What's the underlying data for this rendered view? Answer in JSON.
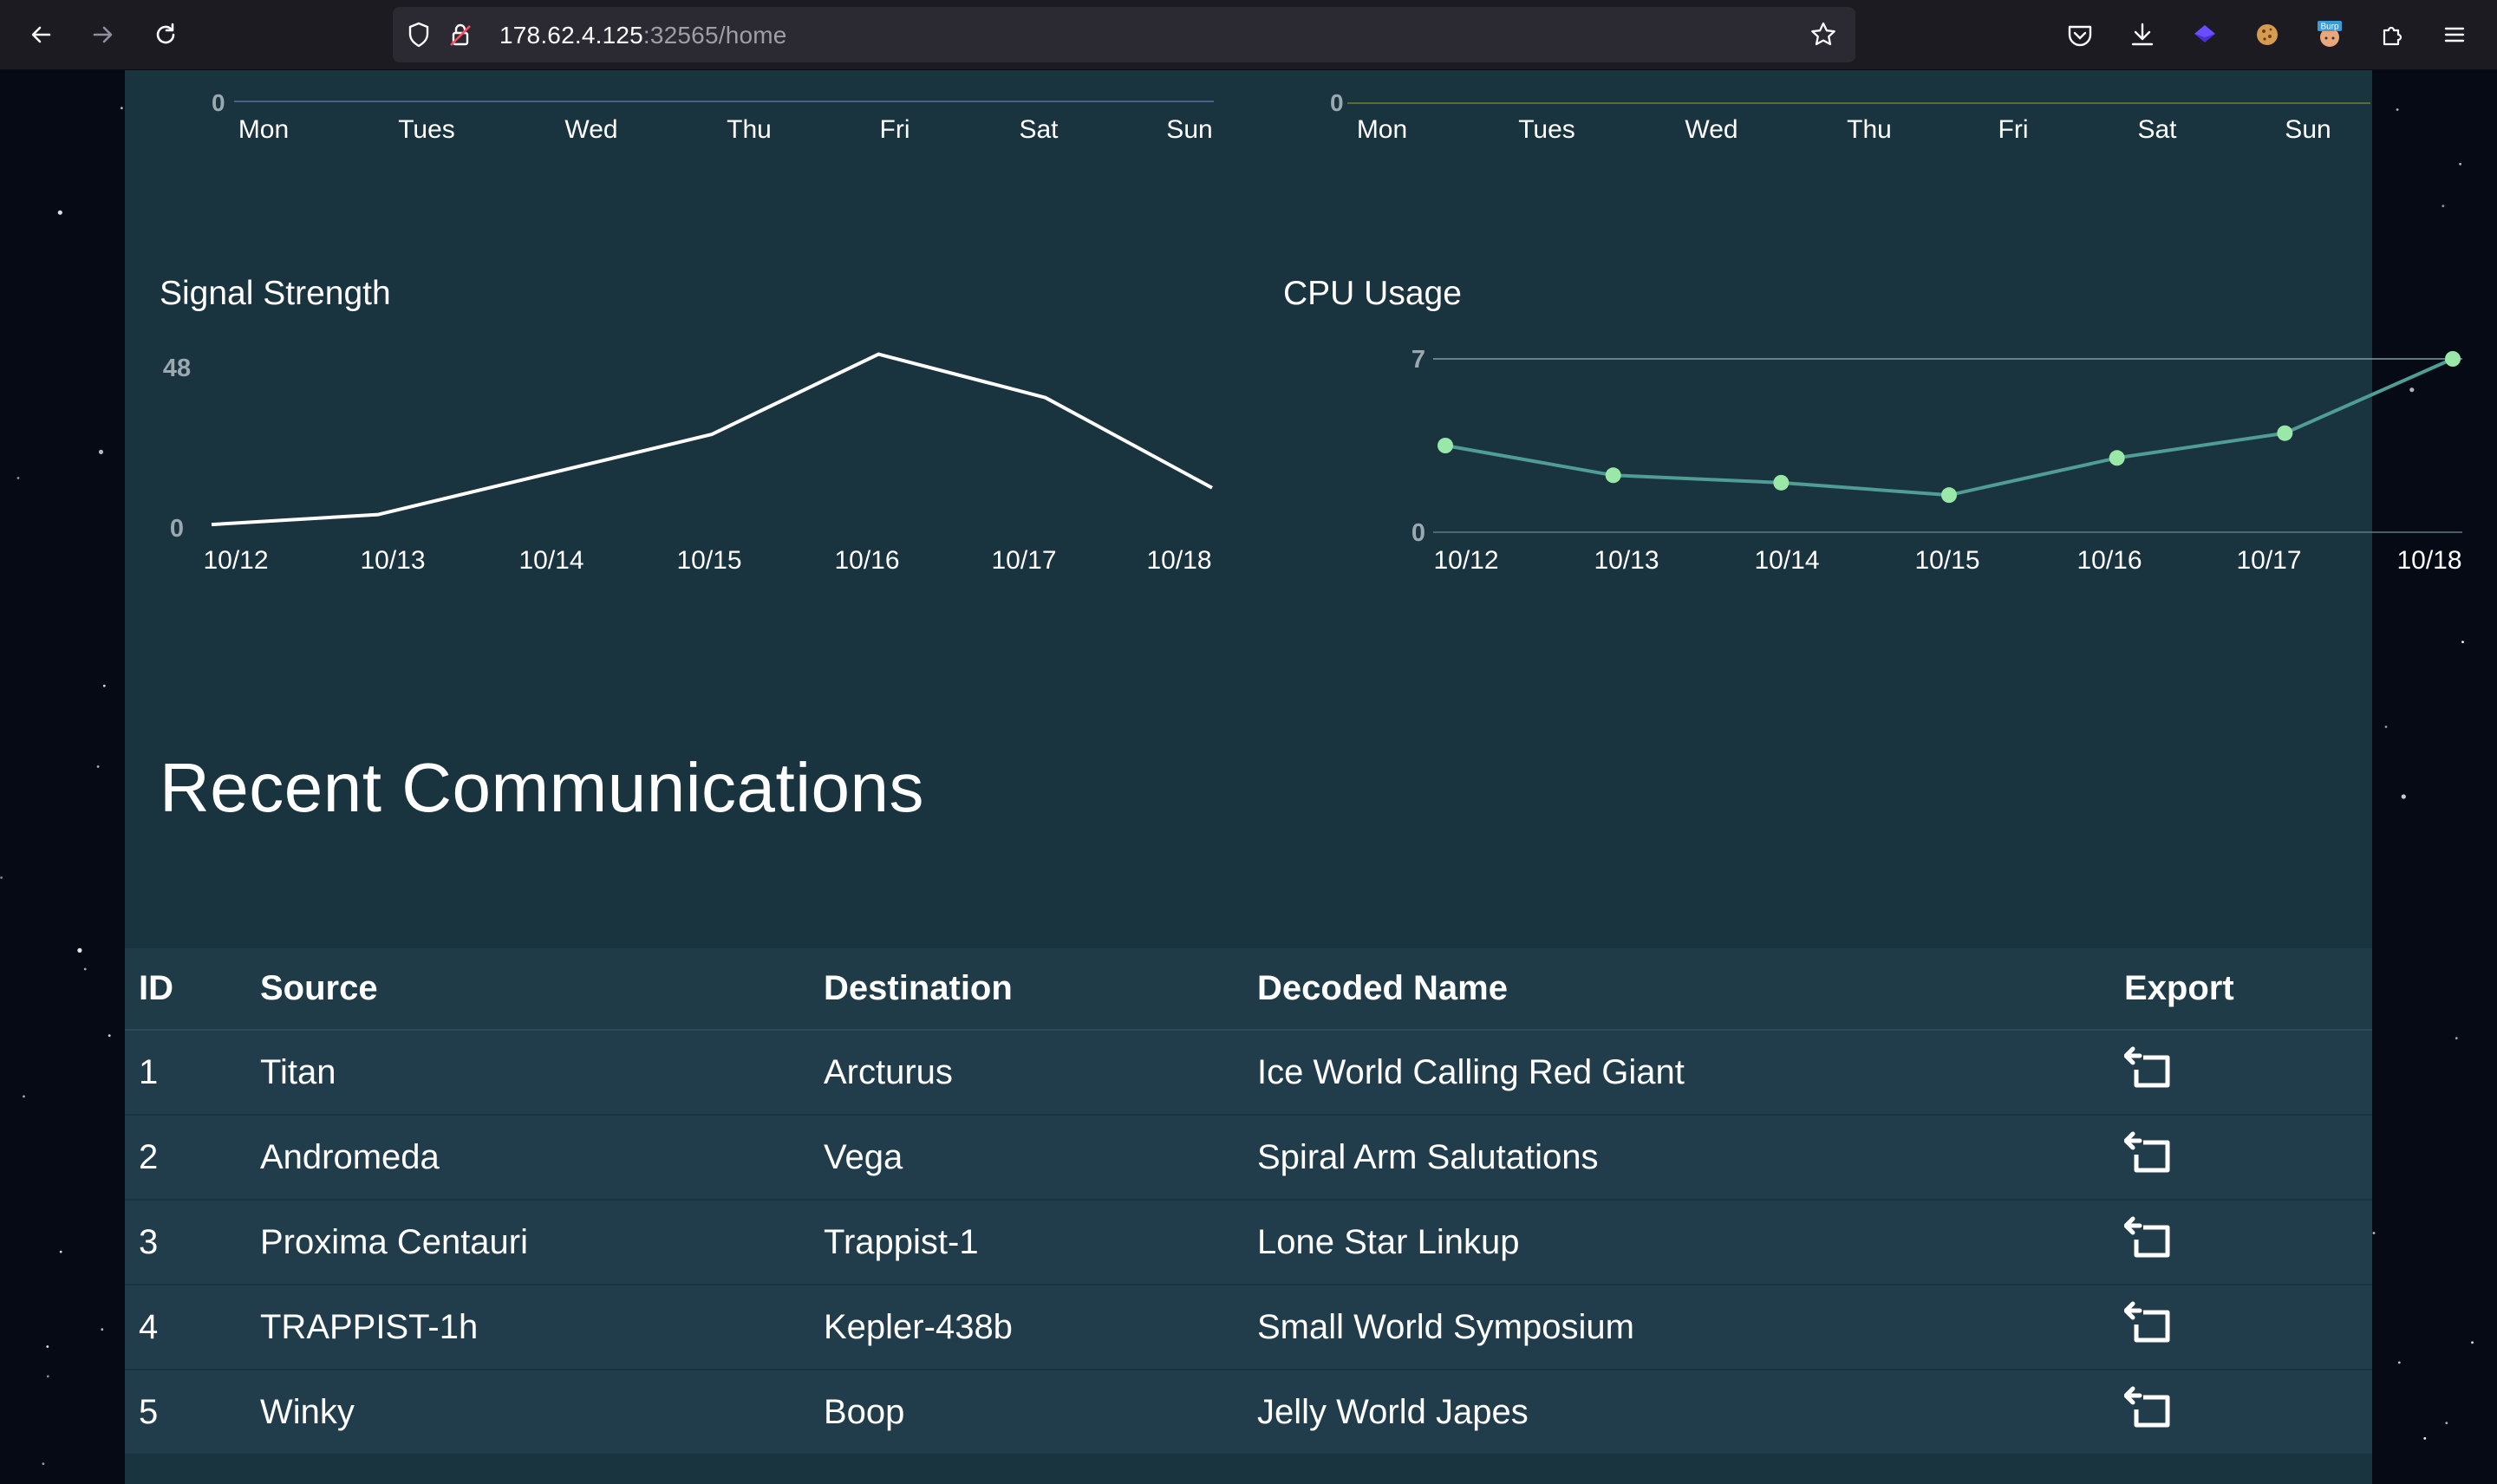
{
  "browser": {
    "url_host": "178.62.4.125",
    "url_path": ":32565/home",
    "extension_badge": "Burp"
  },
  "top_charts": {
    "zero_label": "0",
    "days": [
      "Mon",
      "Tues",
      "Wed",
      "Thu",
      "Fri",
      "Sat",
      "Sun"
    ]
  },
  "chart_data": [
    {
      "type": "line",
      "title": "Signal Strength",
      "x": [
        "10/12",
        "10/13",
        "10/14",
        "10/15",
        "10/16",
        "10/17",
        "10/18"
      ],
      "y_ticks": [
        "48",
        "0"
      ],
      "ylim": [
        0,
        48
      ],
      "series": [
        {
          "values": [
            1,
            4,
            16,
            28,
            52,
            39,
            12
          ],
          "color": "#ffffff",
          "markers": false
        }
      ],
      "grid": false
    },
    {
      "type": "line",
      "title": "CPU Usage",
      "x": [
        "10/12",
        "10/13",
        "10/14",
        "10/15",
        "10/16",
        "10/17",
        "10/18"
      ],
      "y_ticks": [
        "7",
        "0"
      ],
      "ylim": [
        0,
        7
      ],
      "series": [
        {
          "values": [
            3.5,
            2.3,
            2.0,
            1.5,
            3.0,
            4.0,
            7.0
          ],
          "color": "#4f9d94",
          "marker_color": "#99e8a8",
          "markers": true
        }
      ],
      "grid": true
    }
  ],
  "communications": {
    "title": "Recent Communications",
    "columns": [
      "ID",
      "Source",
      "Destination",
      "Decoded Name",
      "Export"
    ],
    "rows": [
      {
        "id": "1",
        "source": "Titan",
        "destination": "Arcturus",
        "decoded_name": "Ice World Calling Red Giant"
      },
      {
        "id": "2",
        "source": "Andromeda",
        "destination": "Vega",
        "decoded_name": "Spiral Arm Salutations"
      },
      {
        "id": "3",
        "source": "Proxima Centauri",
        "destination": "Trappist-1",
        "decoded_name": "Lone Star Linkup"
      },
      {
        "id": "4",
        "source": "TRAPPIST-1h",
        "destination": "Kepler-438b",
        "decoded_name": "Small World Symposium"
      },
      {
        "id": "5",
        "source": "Winky",
        "destination": "Boop",
        "decoded_name": "Jelly World Japes"
      }
    ],
    "export_icon": "export-icon"
  },
  "colors": {
    "panel": "#19333f",
    "space": "#060a14",
    "cpu_line": "#4f9d94",
    "cpu_marker": "#99e8a8"
  }
}
